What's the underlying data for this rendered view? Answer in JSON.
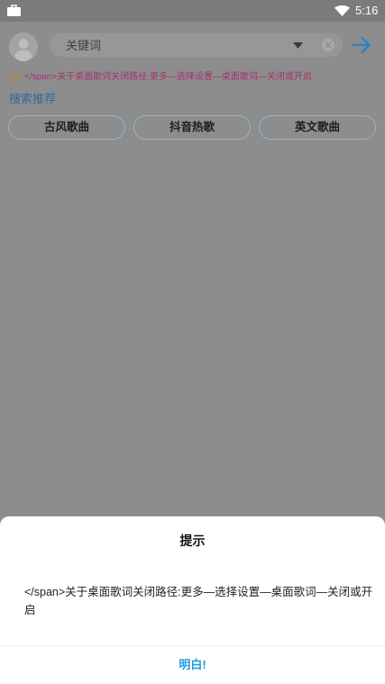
{
  "status_bar": {
    "time": "5:16",
    "icons": [
      "briefcase-icon",
      "wifi-icon"
    ]
  },
  "search": {
    "placeholder": "关键词",
    "icons": [
      "avatar-icon",
      "dropdown-triangle-icon",
      "clear-icon",
      "arrow-right-icon"
    ]
  },
  "notice": {
    "icon": "speaker-icon",
    "text": "</span>关于桌面歌词关闭路径:更多—选择设置—桌面歌词—关闭或开启"
  },
  "recommend": {
    "label": "搜索推荐",
    "tags": [
      {
        "label": "古风歌曲"
      },
      {
        "label": "抖音热歌"
      },
      {
        "label": "英文歌曲"
      }
    ]
  },
  "dialog": {
    "title": "提示",
    "message": "</span>关于桌面歌词关闭路径:更多—选择设置—桌面歌词—关闭或开启",
    "confirm_label": "明白!"
  },
  "theme": {
    "accent": "#2b84c2",
    "notice_text": "#a3326c",
    "dialog_button": "#1e9be0"
  }
}
